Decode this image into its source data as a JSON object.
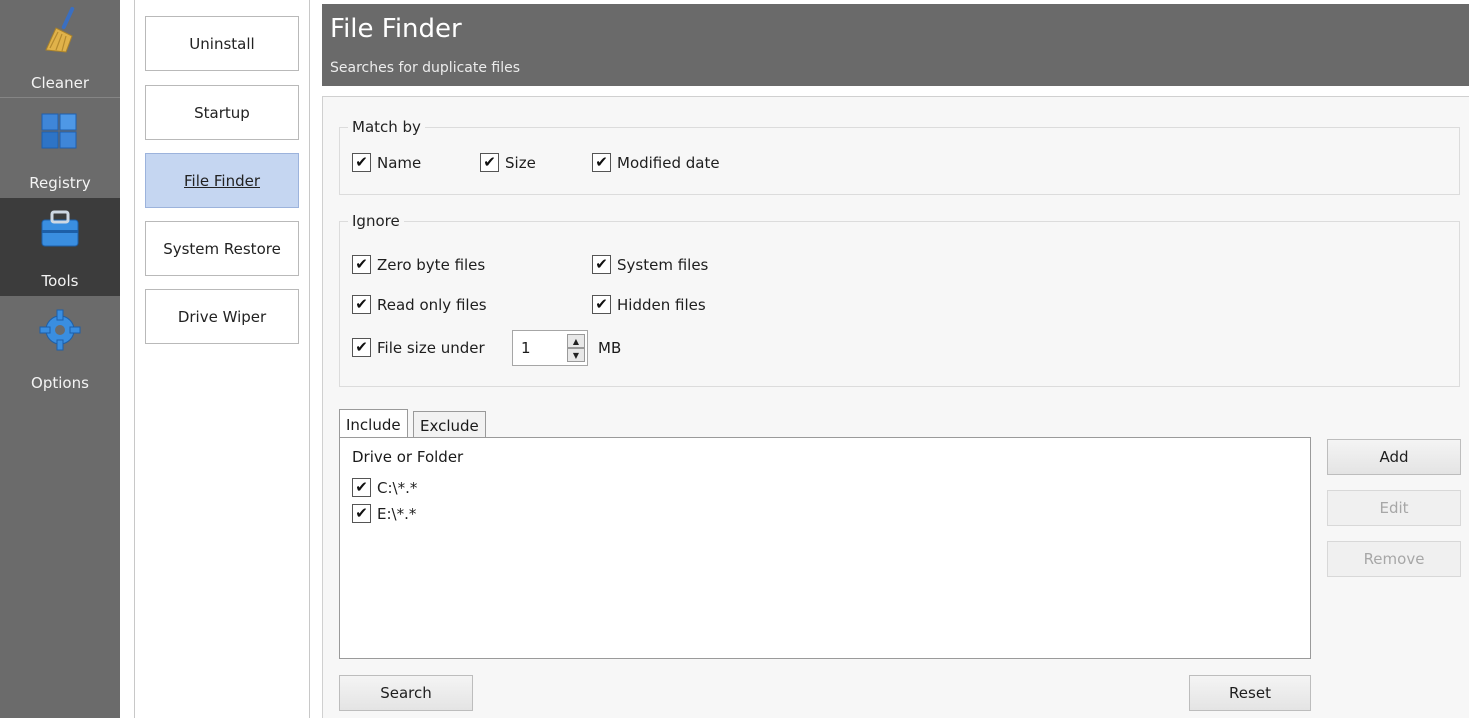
{
  "sidebar": {
    "items": [
      {
        "label": "Cleaner",
        "icon": "broom-icon"
      },
      {
        "label": "Registry",
        "icon": "registry-cubes-icon"
      },
      {
        "label": "Tools",
        "icon": "toolbox-icon"
      },
      {
        "label": "Options",
        "icon": "gear-icon"
      }
    ],
    "active": "Tools"
  },
  "subnav": {
    "items": [
      "Uninstall",
      "Startup",
      "File Finder",
      "System Restore",
      "Drive Wiper"
    ],
    "active": "File Finder"
  },
  "header": {
    "title": "File Finder",
    "subtitle": "Searches for duplicate files"
  },
  "match_by": {
    "legend": "Match by",
    "options": [
      {
        "label": "Name",
        "checked": true
      },
      {
        "label": "Size",
        "checked": true
      },
      {
        "label": "Modified date",
        "checked": true
      }
    ]
  },
  "ignore": {
    "legend": "Ignore",
    "zero_byte": "Zero byte files",
    "system_files": "System files",
    "read_only": "Read only files",
    "hidden_files": "Hidden files",
    "size_under": "File size under",
    "size_value": "1",
    "size_unit": "MB"
  },
  "tabs": {
    "include": "Include",
    "exclude": "Exclude",
    "active": "Include"
  },
  "list": {
    "header": "Drive or Folder",
    "rows": [
      {
        "path": "C:\\*.*",
        "checked": true
      },
      {
        "path": "E:\\*.*",
        "checked": true
      }
    ]
  },
  "buttons": {
    "add": "Add",
    "edit": "Edit",
    "remove": "Remove",
    "search": "Search",
    "reset": "Reset"
  },
  "colors": {
    "sidebar_bg": "#6b6b6b",
    "sidebar_active": "#3c3c3c",
    "header_bg": "#6a6a6a",
    "subnav_active": "#c5d6f1"
  }
}
